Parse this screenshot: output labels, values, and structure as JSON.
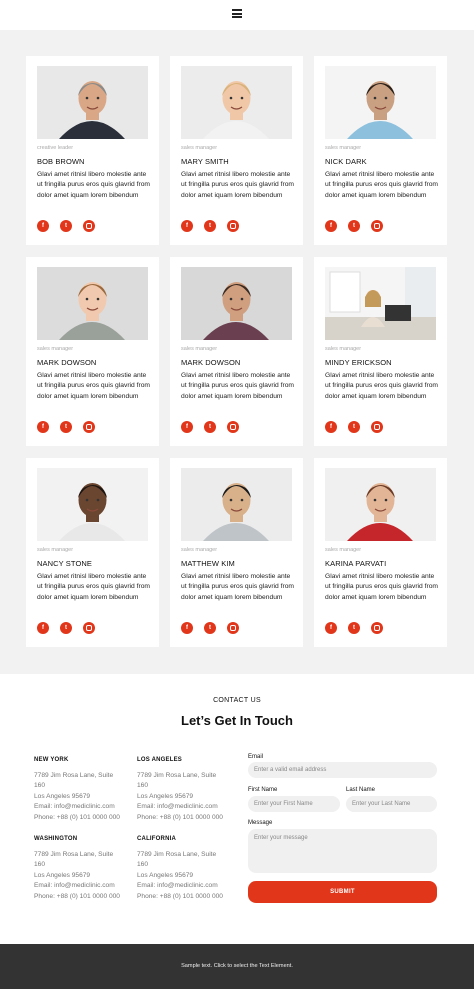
{
  "header": {
    "menu_icon": "hamburger-menu-icon"
  },
  "team": {
    "members": [
      {
        "role": "creative leader",
        "name": "BOB BROWN"
      },
      {
        "role": "sales manager",
        "name": "MARY SMITH"
      },
      {
        "role": "sales manager",
        "name": "NICK DARK"
      },
      {
        "role": "sales manager",
        "name": "MARK DOWSON"
      },
      {
        "role": "sales manager",
        "name": "MARK DOWSON"
      },
      {
        "role": "sales manager",
        "name": "MINDY ERICKSON"
      },
      {
        "role": "sales manager",
        "name": "NANCY STONE"
      },
      {
        "role": "sales manager",
        "name": "MATTHEW KIM"
      },
      {
        "role": "sales manager",
        "name": "KARINA PARVATI"
      }
    ],
    "bio": "Glavi amet ritnisl libero molestie ante ut fringilla purus eros quis glavrid from dolor amet iquam lorem bibendum",
    "social_icons": [
      "facebook-icon",
      "twitter-icon",
      "instagram-icon"
    ],
    "social_glyphs": {
      "facebook": "f",
      "twitter": "t"
    }
  },
  "contact": {
    "eyebrow": "CONTACT US",
    "title": "Let’s Get In Touch",
    "offices": [
      {
        "city": "NEW YORK",
        "lines": [
          "7789 Jim Rosa Lane, Suite",
          "160",
          "Los Angeles 95679",
          "Email: info@mediclinic.com",
          "Phone: +88 (0) 101 0000 000"
        ]
      },
      {
        "city": "LOS ANGELES",
        "lines": [
          "7789 Jim Rosa Lane, Suite",
          "160",
          "Los Angeles 95679",
          "Email: info@mediclinic.com",
          "Phone: +88 (0) 101 0000 000"
        ]
      },
      {
        "city": "WASHINGTON",
        "lines": [
          "7789 Jim Rosa Lane, Suite",
          "160",
          "Los Angeles 95679",
          "Email: info@mediclinic.com",
          "Phone: +88 (0) 101 0000 000"
        ]
      },
      {
        "city": "CALIFORNIA",
        "lines": [
          "7789 Jim Rosa Lane, Suite",
          "160",
          "Los Angeles 95679",
          "Email: info@mediclinic.com",
          "Phone: +88 (0) 101 0000 000"
        ]
      }
    ],
    "form": {
      "email_label": "Email",
      "email_placeholder": "Enter a valid email address",
      "first_name_label": "First Name",
      "first_name_placeholder": "Enter your First Name",
      "last_name_label": "Last Name",
      "last_name_placeholder": "Enter your Last Name",
      "message_label": "Message",
      "message_placeholder": "Enter your message",
      "submit_label": "SUBMIT"
    }
  },
  "footer": {
    "text": "Sample text. Click to select the Text Element."
  },
  "colors": {
    "accent": "#e2361a",
    "section_bg": "#f2f2f2",
    "footer_bg": "#333333"
  }
}
